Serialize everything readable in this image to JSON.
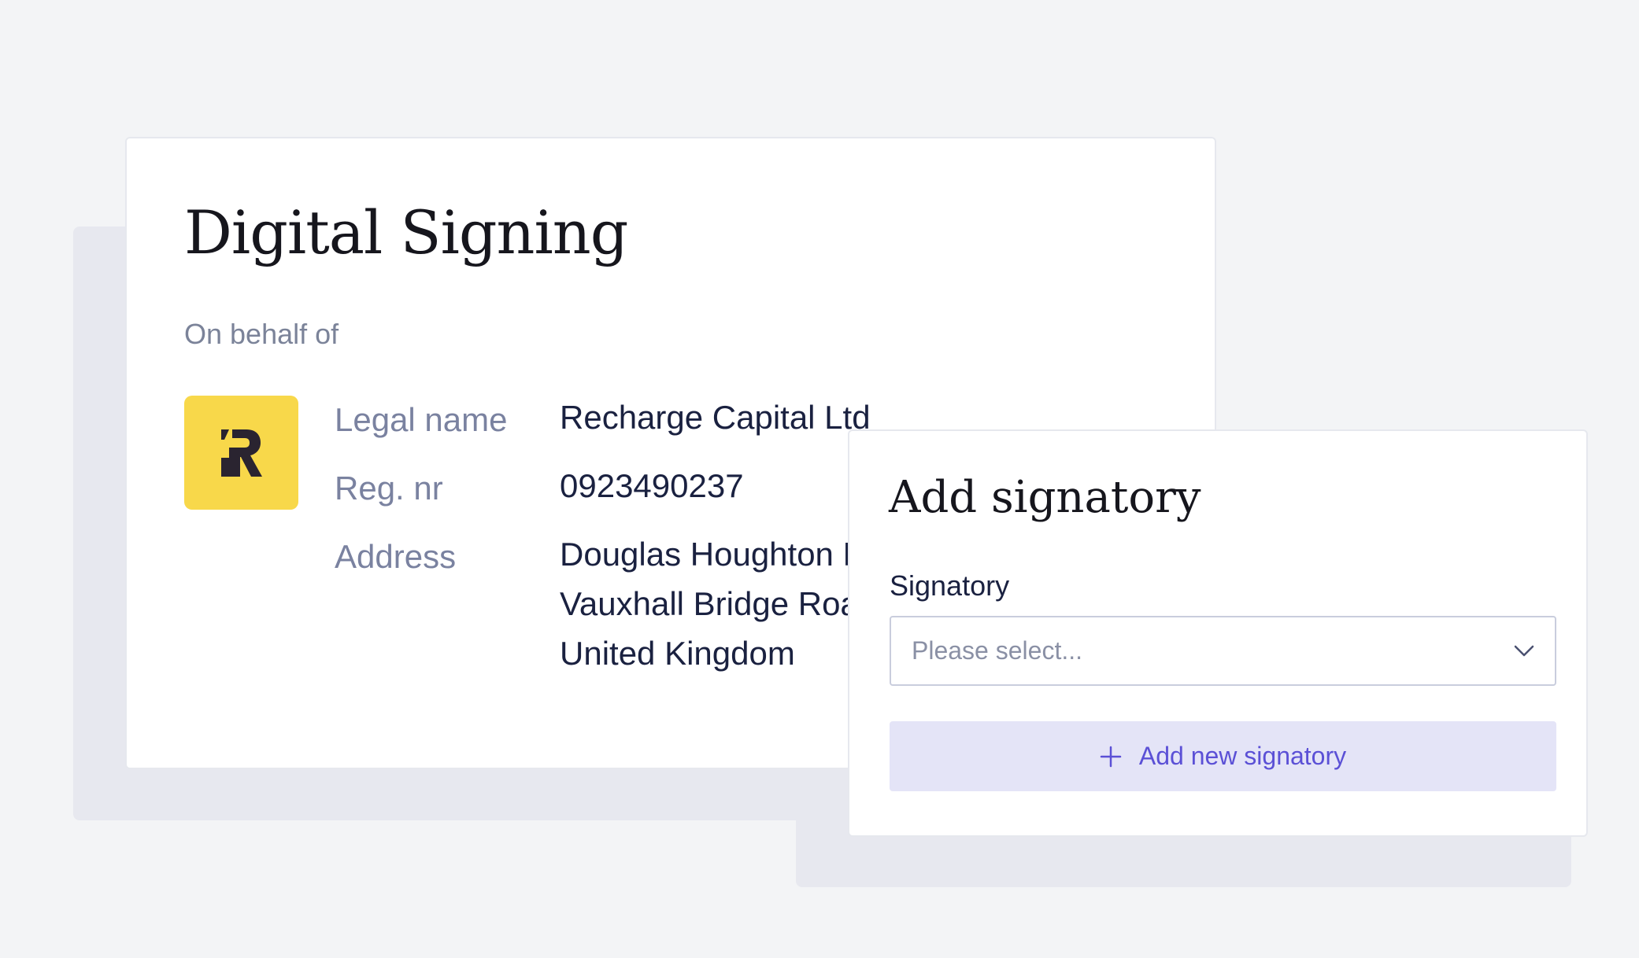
{
  "digital_signing": {
    "title": "Digital Signing",
    "subtitle": "On behalf of",
    "company": {
      "logo_icon": "recharge-logo-icon",
      "legal_name_label": "Legal name",
      "legal_name_value": "Recharge Capital Ltd",
      "reg_label": "Reg. nr",
      "reg_value": "0923490237",
      "address_label": "Address",
      "address_line1": "Douglas Houghton H",
      "address_line2": "Vauxhall Bridge Roa",
      "address_line3": "United Kingdom"
    }
  },
  "add_signatory": {
    "title": "Add signatory",
    "field_label": "Signatory",
    "select_placeholder": "Please select...",
    "select_icon": "chevron-down-icon",
    "add_button_label": "Add new signatory",
    "add_button_icon": "plus-icon"
  },
  "colors": {
    "background": "#f3f4f6",
    "logo_yellow": "#f8d84a",
    "accent_purple": "#5b50d6",
    "button_bg": "#e4e4f7",
    "text_dark": "#1a2140",
    "text_muted": "#7a82a0"
  }
}
